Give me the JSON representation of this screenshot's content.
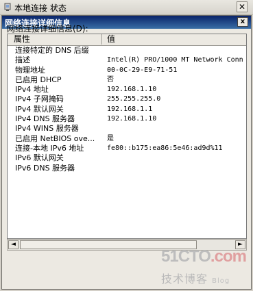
{
  "outer_window": {
    "title": "本地连接 状态",
    "close_glyph": "✕"
  },
  "dialog": {
    "title": "网络连接详细信息",
    "close_glyph": "x",
    "caption": "网络连接详细信息(D):",
    "columns": {
      "property": "属性",
      "value": "值"
    },
    "rows": [
      {
        "property": "连接特定的 DNS 后缀",
        "value": ""
      },
      {
        "property": "描述",
        "value": "Intel(R) PRO/1000 MT Network Conn"
      },
      {
        "property": "物理地址",
        "value": "00-0C-29-E9-71-51"
      },
      {
        "property": "已启用 DHCP",
        "value": "否"
      },
      {
        "property": "IPv4 地址",
        "value": "192.168.1.10"
      },
      {
        "property": "IPv4 子网掩码",
        "value": "255.255.255.0"
      },
      {
        "property": "IPv4 默认网关",
        "value": "192.168.1.1"
      },
      {
        "property": "IPv4 DNS 服务器",
        "value": "192.168.1.10"
      },
      {
        "property": "IPv4 WINS 服务器",
        "value": ""
      },
      {
        "property": "已启用 NetBIOS ove...",
        "value": "是"
      },
      {
        "property": "连接-本地 IPv6 地址",
        "value": "fe80::b175:ea86:5e46:ad9d%11"
      },
      {
        "property": "IPv6 默认网关",
        "value": ""
      },
      {
        "property": "IPv6 DNS 服务器",
        "value": ""
      }
    ],
    "scroll_left_glyph": "◄",
    "scroll_right_glyph": "►"
  },
  "watermark": {
    "brand": "51CTO",
    "dot": ".com",
    "sub": "技术博客",
    "blog": "Blog"
  }
}
